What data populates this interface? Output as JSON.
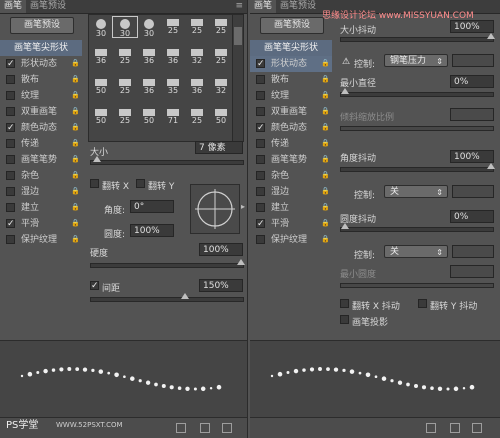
{
  "left": {
    "tabs": [
      "画笔",
      "画笔预设"
    ],
    "preset_button": "画笔预设",
    "list": [
      {
        "label": "画笔笔尖形状",
        "header": true
      },
      {
        "label": "形状动态",
        "checked": true,
        "lock": true
      },
      {
        "label": "散布",
        "checked": false,
        "lock": true
      },
      {
        "label": "纹理",
        "checked": false,
        "lock": true
      },
      {
        "label": "双重画笔",
        "checked": false,
        "lock": true
      },
      {
        "label": "颜色动态",
        "checked": true,
        "lock": true
      },
      {
        "label": "传递",
        "checked": false,
        "lock": true
      },
      {
        "label": "画笔笔势",
        "checked": false,
        "lock": true
      },
      {
        "label": "杂色",
        "checked": false,
        "lock": true
      },
      {
        "label": "湿边",
        "checked": false,
        "lock": true
      },
      {
        "label": "建立",
        "checked": false,
        "lock": true
      },
      {
        "label": "平滑",
        "checked": true,
        "lock": true
      },
      {
        "label": "保护纹理",
        "checked": false,
        "lock": true
      }
    ],
    "tips": [
      "30",
      "30",
      "30",
      "25",
      "25",
      "25",
      "36",
      "25",
      "36",
      "36",
      "32",
      "25",
      "50",
      "25",
      "36",
      "35",
      "36",
      "32",
      "50",
      "25",
      "50",
      "71",
      "25",
      "50"
    ],
    "size_label": "大小",
    "size_value": "7 像素",
    "flip_x": "翻转 X",
    "flip_y": "翻转 Y",
    "angle_label": "角度:",
    "angle_value": "0°",
    "roundness_label": "圆度:",
    "roundness_value": "100%",
    "hardness_label": "硬度",
    "hardness_value": "100%",
    "spacing_label": "间距",
    "spacing_value": "150%",
    "watermark_left": "PS学堂",
    "watermark_right": "WWW.52PSXT.COM"
  },
  "right": {
    "tabs": [
      "画笔",
      "画笔预设"
    ],
    "preset_button": "画笔预设",
    "watermark_top": "思缘设计论坛 www.MISSYUAN.COM",
    "list": [
      {
        "label": "画笔笔尖形状",
        "header": true
      },
      {
        "label": "形状动态",
        "checked": true,
        "lock": true,
        "selected": true
      },
      {
        "label": "散布",
        "checked": false,
        "lock": true
      },
      {
        "label": "纹理",
        "checked": false,
        "lock": true
      },
      {
        "label": "双重画笔",
        "checked": false,
        "lock": true
      },
      {
        "label": "颜色动态",
        "checked": true,
        "lock": true
      },
      {
        "label": "传递",
        "checked": false,
        "lock": true
      },
      {
        "label": "画笔笔势",
        "checked": false,
        "lock": true
      },
      {
        "label": "杂色",
        "checked": false,
        "lock": true
      },
      {
        "label": "湿边",
        "checked": false,
        "lock": true
      },
      {
        "label": "建立",
        "checked": false,
        "lock": true
      },
      {
        "label": "平滑",
        "checked": true,
        "lock": true
      },
      {
        "label": "保护纹理",
        "checked": false,
        "lock": true
      }
    ],
    "size_jitter_label": "大小抖动",
    "size_jitter_value": "100%",
    "control_label": "控制:",
    "control_value_1": "钢笔压力",
    "min_diameter_label": "最小直径",
    "min_diameter_value": "0%",
    "tilt_scale_label": "倾斜缩放比例",
    "angle_jitter_label": "角度抖动",
    "angle_jitter_value": "100%",
    "control_value_2": "关",
    "roundness_jitter_label": "圆度抖动",
    "roundness_jitter_value": "0%",
    "control_value_3": "关",
    "min_roundness_label": "最小圆度",
    "flip_x_jitter": "翻转 X 抖动",
    "flip_y_jitter": "翻转 Y 抖动",
    "brush_projection": "画笔投影"
  },
  "colors": {
    "panel": "#535353",
    "header_highlight": "#5c6b80",
    "field": "#3a3a3a"
  }
}
